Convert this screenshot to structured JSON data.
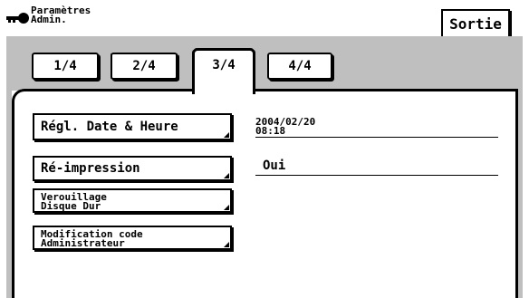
{
  "header": {
    "title_line1": "Paramètres",
    "title_line2": "Admin.",
    "icon": "key-icon"
  },
  "exit_button": {
    "label": "Sortie"
  },
  "tabs": [
    {
      "label": "1/4",
      "active": false
    },
    {
      "label": "2/4",
      "active": false
    },
    {
      "label": "3/4",
      "active": true
    },
    {
      "label": "4/4",
      "active": false
    }
  ],
  "settings": [
    {
      "label": "Régl. Date & Heure",
      "value_line1": "2004/02/20",
      "value_line2": "08:18"
    },
    {
      "label": "Ré-impression",
      "value": "Oui"
    },
    {
      "label_line1": "Verouillage",
      "label_line2": "Disque Dur"
    },
    {
      "label_line1": "Modification code",
      "label_line2": "Administrateur"
    }
  ]
}
